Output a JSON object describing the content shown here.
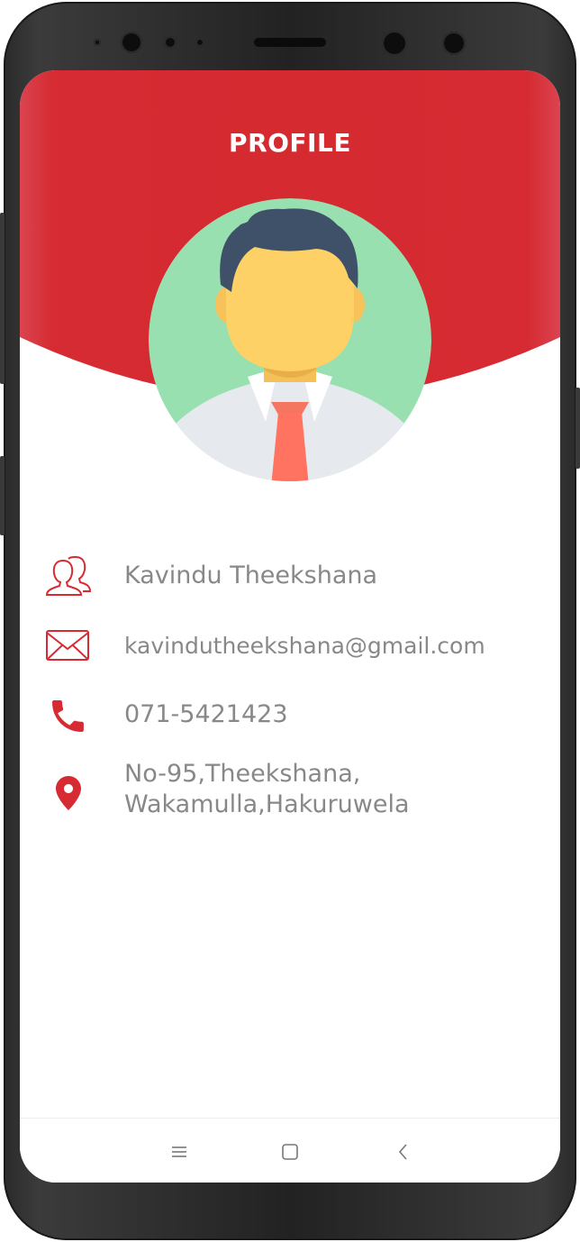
{
  "header": {
    "title": "PROFILE"
  },
  "profile": {
    "name": "Kavindu Theekshana",
    "email": "kavindutheekshana@gmail.com",
    "phone": "071-5421423",
    "address_line1": "No-95,Theekshana,",
    "address_line2": "Wakamulla,Hakuruwela"
  },
  "icons": {
    "name": "users-icon",
    "email": "envelope-icon",
    "phone": "phone-icon",
    "address": "location-pin-icon",
    "nav_menu": "menu-icon",
    "nav_home": "home-square-icon",
    "nav_back": "back-chevron-icon"
  },
  "colors": {
    "accent": "#D62B32",
    "text": "#888888",
    "avatar_bg": "#98E0B0"
  }
}
